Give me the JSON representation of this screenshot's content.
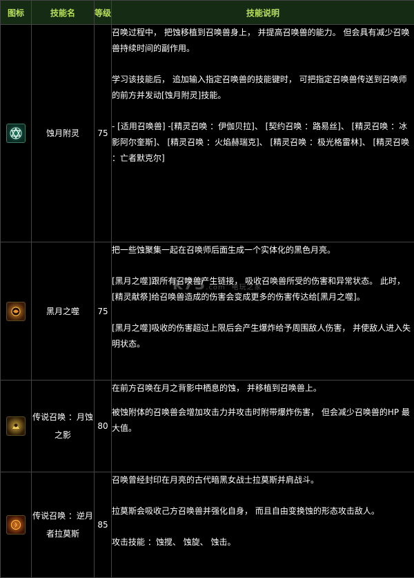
{
  "header": {
    "icon": "图标",
    "name": "技能名",
    "level": "等级",
    "desc": "技能说明"
  },
  "rows": [
    {
      "icon": "six-point-star-icon",
      "name": "蚀月附灵",
      "level": "75",
      "paragraphs": [
        "召唤过程中， 把蚀移植到召唤兽身上， 并提高召唤兽的能力。 但会具有减少召唤兽持续时间的副作用。",
        "学习该技能后， 追加输入指定召唤兽的技能键时， 可把指定召唤兽传送到召唤师的前方并发动[蚀月附灵]技能。",
        "- [适用召唤兽] -[精灵召唤 ：伊伽贝拉]、 [契约召唤 ：路易丝]、 [精灵召唤 ：冰影阿尔奎斯]、 [精灵召唤 ：火焰赫瑞克]、 [精灵召唤 ：极光格雷林]、 [精灵召唤 ：亡者默克尔]"
      ]
    },
    {
      "icon": "black-moon-icon",
      "name": "黑月之噬",
      "level": "75",
      "paragraphs": [
        "把一些蚀聚集一起在召唤师后面生成一个实体化的黑色月亮。",
        "[黑月之噬]跟所有召唤兽产生链接， 吸收召唤兽所受的伤害和异常状态。 此时， [精灵献祭]给召唤兽造成的伤害会变成更多的伤害传达给[黑月之噬]。",
        "[黑月之噬]吸收的伤害超过上限后会产生爆炸给予周围敌人伤害， 并使敌人进入失明状态。"
      ]
    },
    {
      "icon": "moon-shadow-icon",
      "name": "传说召唤 ：月蚀之影",
      "level": "80",
      "paragraphs": [
        "在前方召唤在月之背影中栖息的蚀， 并移植到召唤兽上。",
        "被蚀附体的召唤兽会增加攻击力并攻击时附带爆炸伤害， 但会减少召唤兽的HP 最大值。"
      ]
    },
    {
      "icon": "moon-warrior-icon",
      "name": "传说召唤 ：逆月者拉莫斯",
      "level": "85",
      "paragraphs": [
        "召唤曾经封印在月亮的古代暗黑女战士拉莫斯并肩战斗。",
        "拉莫斯会吸收己方召唤兽并强化自身， 而且自由变换蚀的形态攻击敌人。",
        "攻击技能 ：蚀搅、 蚀旋、 蚀击。"
      ]
    }
  ],
  "watermark": {
    "main": "k73",
    "sub": "电玩之家",
    "domain": ".com"
  }
}
